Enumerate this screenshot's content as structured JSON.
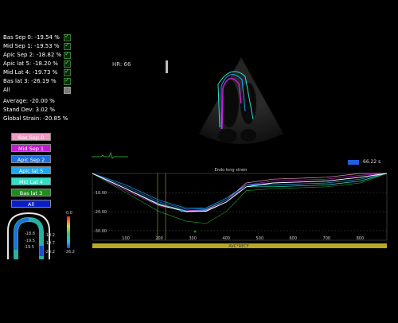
{
  "segments": [
    {
      "label": "Bas Sep 0: -19.54 %",
      "checked": true
    },
    {
      "label": "Mid Sep 1: -19.53 %",
      "checked": true
    },
    {
      "label": "Apic Sep 2: -18.82 %",
      "checked": true
    },
    {
      "label": "Apic lat 5: -18.20 %",
      "checked": true
    },
    {
      "label": "Mid Lat 4: -19.73 %",
      "checked": true
    },
    {
      "label": "Bas lat 3: -26.19 %",
      "checked": true
    },
    {
      "label": "All",
      "checked": false
    }
  ],
  "stats": {
    "average": "Average: -20.00 %",
    "stdev": "Stand Dev: 3.02 %",
    "global": "Global Strain: -20.85 %"
  },
  "buttons": [
    {
      "label": "Bas Sep 0",
      "bg": "#f29ac2",
      "fg": "#ffffff"
    },
    {
      "label": "Mid Sep 1",
      "bg": "#c11ed0",
      "fg": "#ffffff"
    },
    {
      "label": "Apic Sep 2",
      "bg": "#1e6fe0",
      "fg": "#ffffff"
    },
    {
      "label": "Apic lat 5",
      "bg": "#1ea7f0",
      "fg": "#ffffff"
    },
    {
      "label": "Mid Lat 4",
      "bg": "#2fe0c8",
      "fg": "#ffffff"
    },
    {
      "label": "Bas lat 3",
      "bg": "#1a8f1a",
      "fg": "#ffffff"
    },
    {
      "label": "All",
      "bg": "#0a1fc8",
      "fg": "#ffffff"
    }
  ],
  "image": {
    "hr": "HR: 66"
  },
  "chart": {
    "title": "Endo long strain",
    "time_readout": "66.22 s",
    "bottom_label": "AVC*RECF",
    "yticks": [
      "-10.00",
      "-20.00",
      "-30.00"
    ],
    "xticks": [
      "100",
      "200",
      "300",
      "400",
      "500",
      "600",
      "700",
      "800"
    ]
  },
  "bullseye": {
    "scale_top": "0.0",
    "scale_bottom": "-26.2",
    "labels": [
      "-19.5",
      "-19.5",
      "-18.8",
      "-18.2",
      "-19.7",
      "-26.2"
    ]
  },
  "chart_data": {
    "type": "line",
    "title": "Endo long strain",
    "xlabel": "",
    "ylabel": "",
    "x_ticks": [
      100,
      200,
      300,
      400,
      500,
      600,
      700,
      800
    ],
    "ylim": [
      -35,
      0
    ],
    "series": [
      {
        "color": "#f29ac2",
        "values": [
          [
            0,
            0
          ],
          [
            100,
            -8
          ],
          [
            200,
            -16
          ],
          [
            280,
            -19.5
          ],
          [
            340,
            -19
          ],
          [
            400,
            -14
          ],
          [
            460,
            -5
          ],
          [
            540,
            -3
          ],
          [
            700,
            -2
          ],
          [
            800,
            0
          ],
          [
            880,
            0
          ]
        ]
      },
      {
        "color": "#c11ed0",
        "values": [
          [
            0,
            0
          ],
          [
            100,
            -9
          ],
          [
            200,
            -17
          ],
          [
            280,
            -19.5
          ],
          [
            340,
            -19.3
          ],
          [
            400,
            -15
          ],
          [
            460,
            -6
          ],
          [
            540,
            -4
          ],
          [
            700,
            -3
          ],
          [
            800,
            -1
          ],
          [
            880,
            0
          ]
        ]
      },
      {
        "color": "#1e6fe0",
        "values": [
          [
            0,
            0
          ],
          [
            100,
            -7
          ],
          [
            200,
            -15
          ],
          [
            280,
            -18.8
          ],
          [
            340,
            -18.5
          ],
          [
            400,
            -14
          ],
          [
            460,
            -6
          ],
          [
            540,
            -5
          ],
          [
            700,
            -4
          ],
          [
            800,
            -2
          ],
          [
            880,
            0
          ]
        ]
      },
      {
        "color": "#1ea7f0",
        "values": [
          [
            0,
            0
          ],
          [
            100,
            -6
          ],
          [
            200,
            -14
          ],
          [
            280,
            -18.2
          ],
          [
            340,
            -18
          ],
          [
            400,
            -13
          ],
          [
            460,
            -6
          ],
          [
            540,
            -6
          ],
          [
            700,
            -5
          ],
          [
            800,
            -3
          ],
          [
            880,
            0
          ]
        ]
      },
      {
        "color": "#2fe0c8",
        "values": [
          [
            0,
            0
          ],
          [
            100,
            -8
          ],
          [
            200,
            -16
          ],
          [
            280,
            -19.7
          ],
          [
            340,
            -19.5
          ],
          [
            400,
            -15
          ],
          [
            460,
            -7
          ],
          [
            540,
            -7
          ],
          [
            700,
            -6
          ],
          [
            800,
            -4
          ],
          [
            880,
            0
          ]
        ]
      },
      {
        "color": "#1a8f1a",
        "values": [
          [
            0,
            0
          ],
          [
            100,
            -10
          ],
          [
            200,
            -20
          ],
          [
            280,
            -25
          ],
          [
            340,
            -26.2
          ],
          [
            400,
            -20
          ],
          [
            460,
            -9
          ],
          [
            540,
            -8
          ],
          [
            700,
            -7
          ],
          [
            800,
            -5
          ],
          [
            880,
            0
          ]
        ]
      },
      {
        "color": "#ffffff",
        "values": [
          [
            0,
            0
          ],
          [
            100,
            -8
          ],
          [
            200,
            -16.5
          ],
          [
            280,
            -20
          ],
          [
            340,
            -19.8
          ],
          [
            400,
            -15
          ],
          [
            460,
            -7
          ],
          [
            540,
            -5
          ],
          [
            700,
            -4
          ],
          [
            800,
            -2
          ],
          [
            880,
            0
          ]
        ]
      }
    ]
  },
  "colors": {
    "background": "#000000",
    "grid": "#555555",
    "axis_bar": "#b8a826"
  }
}
